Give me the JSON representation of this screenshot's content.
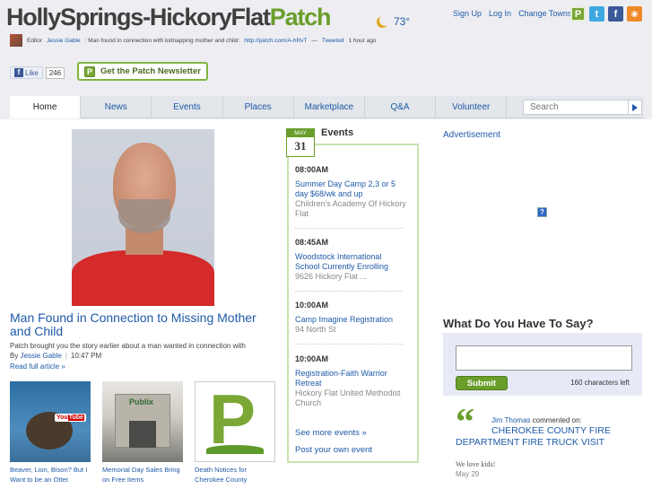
{
  "header": {
    "site_name_prefix": "HollySprings-HickoryFlat",
    "site_name_brand": "Patch",
    "temperature": "73°",
    "links": {
      "sign_up": "Sign Up",
      "log_in": "Log In",
      "change_towns": "Change Towns"
    },
    "social_icons": [
      "patch-icon",
      "twitter-icon",
      "facebook-icon",
      "rss-icon"
    ]
  },
  "tweet": {
    "label": "Editor",
    "author": "Jessie Gable",
    "text": ": Man found in connection with kidnapping mother and child:",
    "link": "http://patch.com/A-hRvT",
    "suffix": "—",
    "via": "Tweeted",
    "time": "1 hour ago"
  },
  "like": {
    "label": "Like",
    "count": "246"
  },
  "newsletter": {
    "label": "Get the Patch Newsletter"
  },
  "nav": {
    "tabs": [
      "Home",
      "News",
      "Events",
      "Places",
      "Marketplace",
      "Q&A",
      "Volunteer"
    ],
    "active": "Home",
    "search_placeholder": "Search"
  },
  "lead": {
    "title": "Man Found in Connection to Missing Mother and Child",
    "summary": "Patch brought you the story earlier about a man wanted in connection with",
    "by": "By",
    "author": "Jessie Gable",
    "time": "10:47 PM",
    "more": "Read full article »"
  },
  "thumbs": [
    {
      "caption": "Beaver, Lion, Bison? But I Want to be an Otter."
    },
    {
      "caption": "Memorial Day Sales Bring on Free Items"
    },
    {
      "caption": "Death Notices for Cherokee County"
    }
  ],
  "events": {
    "heading": "Events",
    "date_month": "MAY",
    "date_day": "31",
    "items": [
      {
        "time": "08:00AM",
        "name": "Summer Day Camp 2,3 or 5 day $68/wk and up",
        "venue": "Children's Academy Of Hickory Flat"
      },
      {
        "time": "08:45AM",
        "name": "Woodstock International School Currently Enrolling",
        "venue": "9626 Hickory Flat ..."
      },
      {
        "time": "10:00AM",
        "name": "Camp Imagine Registration",
        "venue": "94 North St"
      },
      {
        "time": "10:00AM",
        "name": "Registration-Faith Warrior Retreat",
        "venue": "Hickory Flat United Methodist Church"
      }
    ],
    "see_more": "See more events »",
    "post": "Post your own event"
  },
  "sidebar": {
    "ad_label": "Advertisement",
    "say_heading": "What Do You Have To Say?",
    "submit": "Submit",
    "chars_left": "160 characters left",
    "comment": {
      "author": "Jim Thomas",
      "action": "commented on:",
      "title": "CHEROKEE COUNTY FIRE DEPARTMENT FIRE TRUCK VISIT",
      "body": "We love kids!",
      "date": "May 29"
    }
  },
  "colors": {
    "brand_green": "#6a9e2b",
    "link_blue": "#1f5aa8"
  }
}
